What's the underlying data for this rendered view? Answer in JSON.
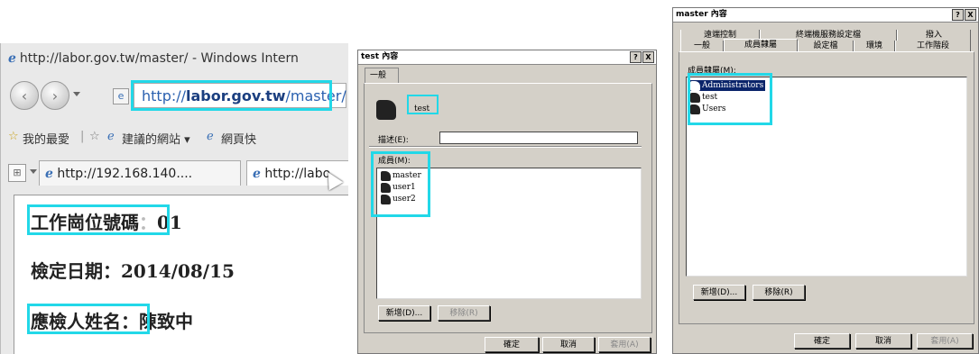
{
  "browser": {
    "window_title": "http://labor.gov.tw/master/ - Windows Intern",
    "address_prefix": "http://",
    "address_host": "labor.gov.tw",
    "address_path": "/master/",
    "favorites_label": "我的最愛",
    "suggested_sites": "建議的網站 ▾",
    "web_slice": "網頁快",
    "tab1_label": "http://192.168.140....",
    "tab2_label": "http://labo",
    "line1_label": "工作崗位號碼",
    "line1_value": "01",
    "line2_label": "檢定日期：",
    "line2_value": "2014/08/15",
    "line3_label": "應檢人姓名",
    "line3_value": "陳致中",
    "colon": "："
  },
  "dialog_test": {
    "title": "test 內容",
    "help_btn": "?",
    "close_btn": "X",
    "tab_general": "一般",
    "group_name": "test",
    "desc_label": "描述(E):",
    "members_label": "成員(M):",
    "members": [
      "master",
      "user1",
      "user2"
    ],
    "add_btn": "新增(D)...",
    "remove_btn": "移除(R)",
    "ok_btn": "確定",
    "cancel_btn": "取消",
    "apply_btn": "套用(A)"
  },
  "dialog_master": {
    "title": "master 內容",
    "help_btn": "?",
    "close_btn": "X",
    "tabs_top": [
      "遠端控制",
      "終端機服務設定檔",
      "撥入"
    ],
    "tabs_bottom": [
      "一般",
      "成員隸屬",
      "設定檔",
      "環境",
      "工作階段"
    ],
    "member_of_label": "成員隸屬(M):",
    "member_of": [
      "Administrators",
      "test",
      "Users"
    ],
    "add_btn": "新增(D)...",
    "remove_btn": "移除(R)",
    "ok_btn": "確定",
    "cancel_btn": "取消",
    "apply_btn": "套用(A)"
  },
  "colors": {
    "highlight": "#22d8e8",
    "dialog_bg": "#d4d0c8"
  }
}
